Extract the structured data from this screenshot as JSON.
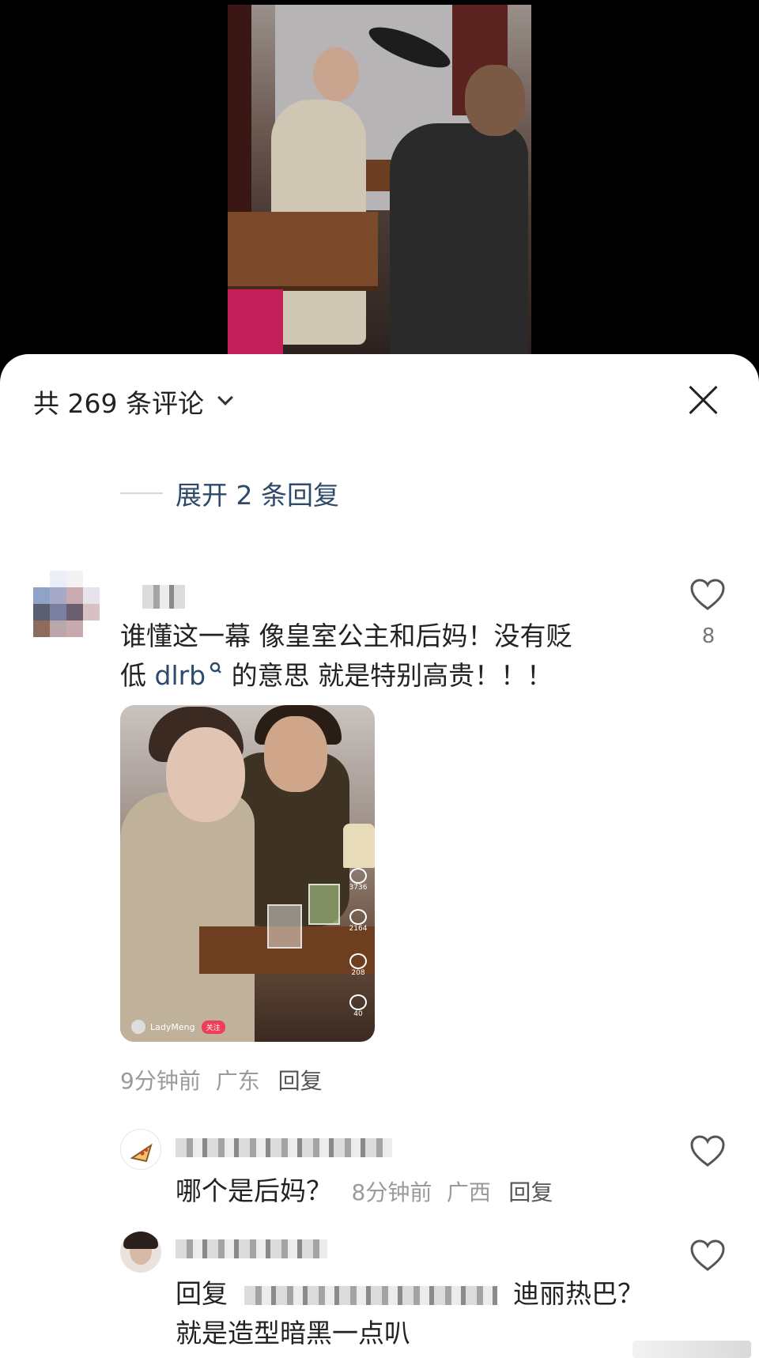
{
  "header": {
    "comment_count_title": "共 269 条评论"
  },
  "thread": {
    "expand_replies": "展开 2 条回复"
  },
  "comment_main": {
    "text_line1": "谁懂这一幕 像皇室公主和后妈！没有贬",
    "text_prefix": "低 ",
    "mention": "dlrb",
    "mention_icon": "search-icon",
    "text_suffix": " 的意思 就是特别高贵！！！",
    "time": "9分钟前",
    "location": "广东",
    "reply_label": "回复",
    "like_count": "8",
    "embed": {
      "username": "LadyMeng",
      "follow_label": "关注",
      "stats": [
        "3736",
        "2164",
        "208",
        "40"
      ]
    }
  },
  "reply_1": {
    "avatar_icon": "pizza-icon",
    "text": "哪个是后妈？",
    "time": "8分钟前",
    "location": "广西",
    "reply_label": "回复"
  },
  "reply_2": {
    "line1_prefix": "回复",
    "line1_suffix": "迪丽热巴？",
    "line2": "就是造型暗黑一点叭"
  },
  "colors": {
    "mention": "#2e4a6b",
    "meta": "#9a9a9a",
    "text": "#222222"
  }
}
